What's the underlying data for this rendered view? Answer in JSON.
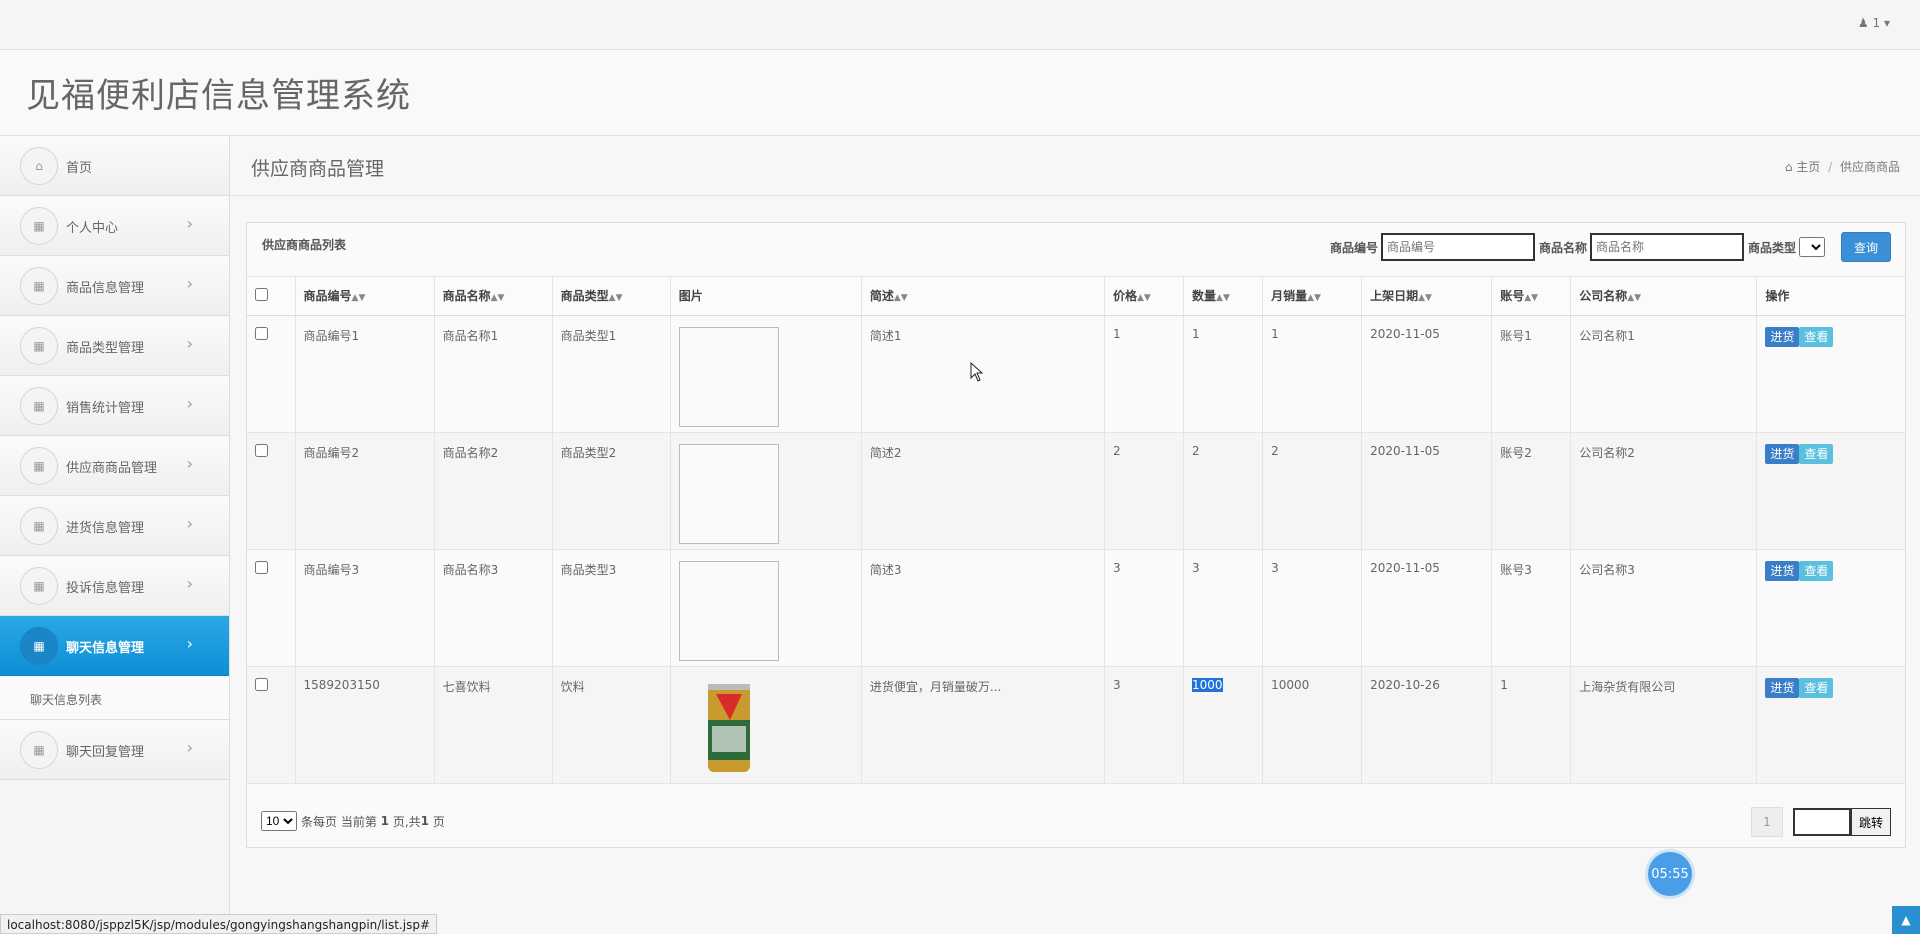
{
  "header": {
    "user": "1"
  },
  "brand": {
    "title": "见福便利店信息管理系统"
  },
  "sidebar": {
    "items": [
      {
        "label": "首页",
        "icon": "home-icon",
        "chev": false,
        "active": false
      },
      {
        "label": "个人中心",
        "icon": "grid-icon",
        "chev": true,
        "active": false
      },
      {
        "label": "商品信息管理",
        "icon": "grid-icon",
        "chev": true,
        "active": false
      },
      {
        "label": "商品类型管理",
        "icon": "grid-icon",
        "chev": true,
        "active": false
      },
      {
        "label": "销售统计管理",
        "icon": "grid-icon",
        "chev": true,
        "active": false
      },
      {
        "label": "供应商商品管理",
        "icon": "grid-icon",
        "chev": true,
        "active": false
      },
      {
        "label": "进货信息管理",
        "icon": "grid-icon",
        "chev": true,
        "active": false
      },
      {
        "label": "投诉信息管理",
        "icon": "grid-icon",
        "chev": true,
        "active": false
      },
      {
        "label": "聊天信息管理",
        "icon": "grid-icon",
        "chev": true,
        "active": true
      },
      {
        "label": "聊天回复管理",
        "icon": "grid-icon",
        "chev": true,
        "active": false
      }
    ],
    "sub_item": "聊天信息列表"
  },
  "page": {
    "title": "供应商商品管理",
    "breadcrumb_home": "主页",
    "breadcrumb_sep": "/",
    "breadcrumb_current": "供应商商品"
  },
  "panel": {
    "title": "供应商商品列表",
    "search": {
      "code_label": "商品编号",
      "code_placeholder": "商品编号",
      "name_label": "商品名称",
      "name_placeholder": "商品名称",
      "type_label": "商品类型",
      "query_button": "查询"
    },
    "columns": [
      "商品编号",
      "商品名称",
      "商品类型",
      "图片",
      "简述",
      "价格",
      "数量",
      "月销量",
      "上架日期",
      "账号",
      "公司名称",
      "操作"
    ],
    "rows": [
      {
        "code": "商品编号1",
        "name": "商品名称1",
        "type": "商品类型1",
        "desc": "简述1",
        "price": "1",
        "qty": "1",
        "sales": "1",
        "date": "2020-11-05",
        "account": "账号1",
        "company": "公司名称1"
      },
      {
        "code": "商品编号2",
        "name": "商品名称2",
        "type": "商品类型2",
        "desc": "简述2",
        "price": "2",
        "qty": "2",
        "sales": "2",
        "date": "2020-11-05",
        "account": "账号2",
        "company": "公司名称2"
      },
      {
        "code": "商品编号3",
        "name": "商品名称3",
        "type": "商品类型3",
        "desc": "简述3",
        "price": "3",
        "qty": "3",
        "sales": "3",
        "date": "2020-11-05",
        "account": "账号3",
        "company": "公司名称3"
      },
      {
        "code": "1589203150",
        "name": "七喜饮料",
        "type": "饮料",
        "desc": "进货便宜，月销量破万...",
        "price": "3",
        "qty": "1000",
        "sales": "10000",
        "date": "2020-10-26",
        "account": "1",
        "company": "上海杂货有限公司"
      }
    ],
    "actions": {
      "restock": "进货",
      "view": "查看"
    },
    "footer": {
      "page_size": "10",
      "per_page_text": "条每页 当前第",
      "current_page": "1",
      "page_word": "页,共",
      "total_pages": "1",
      "page_end": "页",
      "pager_num": "1",
      "go_button": "跳转"
    }
  },
  "timer": "05:55",
  "status_url": "localhost:8080/jsppzl5K/jsp/modules/gongyingshangshangpin/list.jsp#",
  "colors": {
    "accent": "#1a96dc",
    "button": "#3b8fd6",
    "info": "#5bc0de"
  }
}
